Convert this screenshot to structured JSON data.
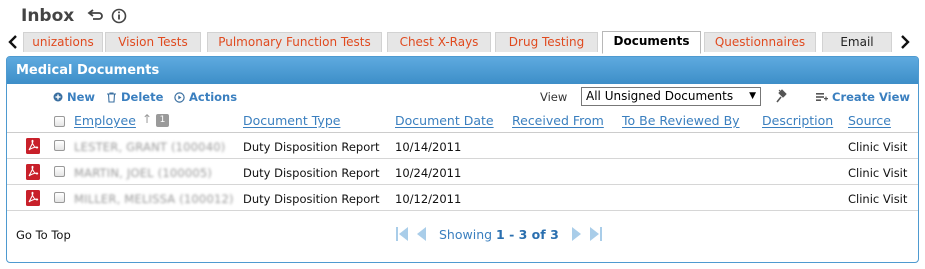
{
  "header": {
    "title": "Inbox"
  },
  "tabs": [
    {
      "label": "unizations",
      "active": false
    },
    {
      "label": "Vision Tests",
      "active": false
    },
    {
      "label": "Pulmonary Function Tests",
      "active": false
    },
    {
      "label": "Chest X-Rays",
      "active": false
    },
    {
      "label": "Drug Testing",
      "active": false
    },
    {
      "label": "Documents",
      "active": true
    },
    {
      "label": "Questionnaires",
      "active": false
    },
    {
      "label": "Email",
      "active": false
    }
  ],
  "panel": {
    "title": "Medical Documents"
  },
  "toolbar": {
    "new_label": "New",
    "delete_label": "Delete",
    "actions_label": "Actions",
    "view_label": "View",
    "view_value": "All Unsigned Documents",
    "create_view_label": "Create View"
  },
  "grid": {
    "columns": [
      "Employee",
      "Document Type",
      "Document Date",
      "Received From",
      "To Be Reviewed By",
      "Description",
      "Source"
    ],
    "sort_badge": "1",
    "rows": [
      {
        "employee": "LESTER, GRANT (100040)",
        "doc_type": "Duty Disposition Report",
        "doc_date": "10/14/2011",
        "source": "Clinic Visit"
      },
      {
        "employee": "MARTIN, JOEL (100005)",
        "doc_type": "Duty Disposition Report",
        "doc_date": "10/24/2011",
        "source": "Clinic Visit"
      },
      {
        "employee": "MILLER, MELISSA (100012)",
        "doc_type": "Duty Disposition Report",
        "doc_date": "10/12/2011",
        "source": "Clinic Visit"
      }
    ]
  },
  "footer": {
    "goto_top": "Go To Top",
    "showing_prefix": "Showing",
    "showing_range": "1 - 3 of 3"
  },
  "colors": {
    "accent": "#4c9bd3",
    "link": "#3a7fbf",
    "tab_text": "#e04a1f",
    "pdf_red": "#c8202a"
  }
}
